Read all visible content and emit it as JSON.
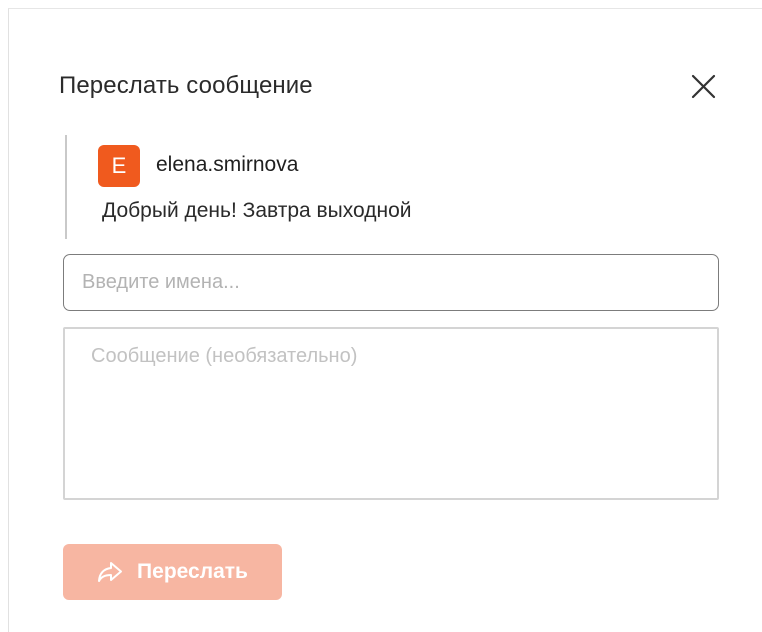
{
  "dialog": {
    "title": "Переслать сообщение",
    "close_icon": "close-icon"
  },
  "quoted_message": {
    "avatar_letter": "E",
    "avatar_color": "#f05a1e",
    "author": "elena.smirnova",
    "text": "Добрый день! Завтра выходной"
  },
  "recipients": {
    "value": "",
    "placeholder": "Введите имена..."
  },
  "message_field": {
    "value": "",
    "placeholder": "Сообщение (необязательно)"
  },
  "send_button": {
    "label": "Переслать",
    "icon": "forward-arrow-icon",
    "background": "#f7b6a2",
    "disabled": true
  }
}
